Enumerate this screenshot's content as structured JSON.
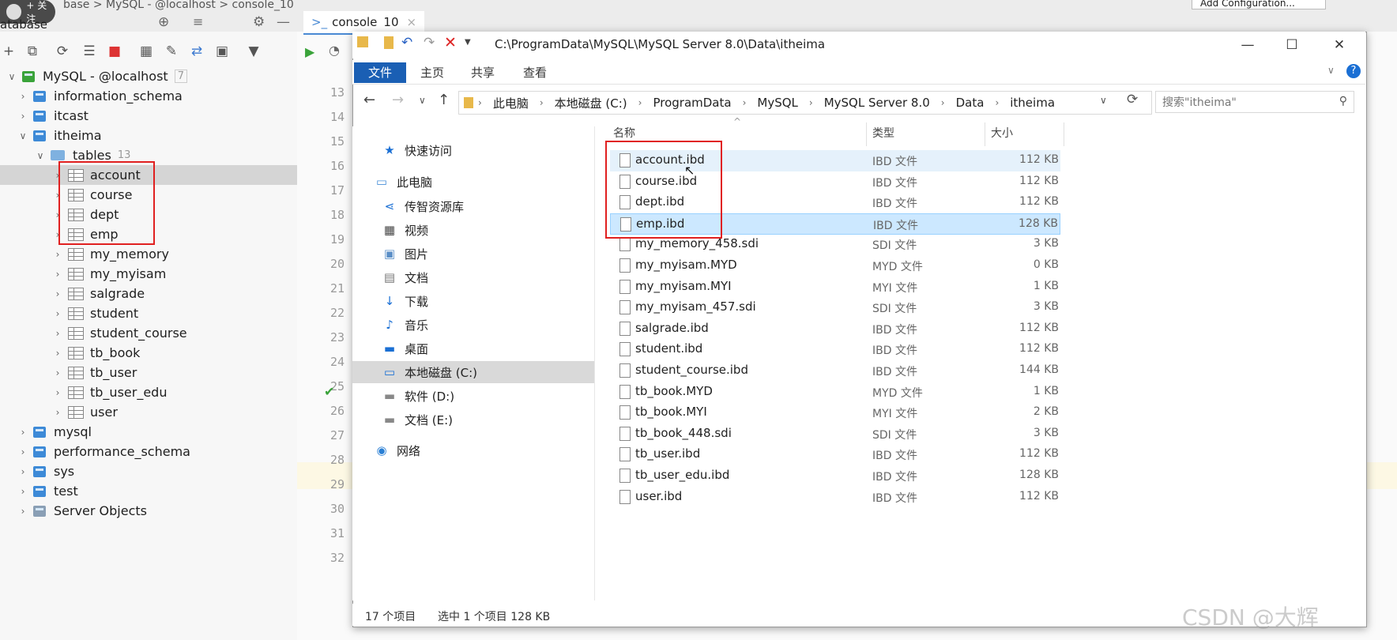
{
  "ide": {
    "top_crumbs": "base > MySQL - @localhost > console_10",
    "follow_badge": "+ 关注",
    "panel_title": "atabase",
    "run_config": "Add Configuration...",
    "console_tab": "console",
    "console_tab_num": "10",
    "tree": [
      {
        "label": "MySQL - @localhost",
        "count": "7"
      },
      {
        "label": "information_schema"
      },
      {
        "label": "itcast"
      },
      {
        "label": "itheima"
      },
      {
        "label": "tables",
        "count": "13"
      },
      {
        "label": "account"
      },
      {
        "label": "course"
      },
      {
        "label": "dept"
      },
      {
        "label": "emp"
      },
      {
        "label": "my_memory"
      },
      {
        "label": "my_myisam"
      },
      {
        "label": "salgrade"
      },
      {
        "label": "student"
      },
      {
        "label": "student_course"
      },
      {
        "label": "tb_book"
      },
      {
        "label": "tb_user"
      },
      {
        "label": "tb_user_edu"
      },
      {
        "label": "user"
      },
      {
        "label": "mysql"
      },
      {
        "label": "performance_schema"
      },
      {
        "label": "sys"
      },
      {
        "label": "test"
      },
      {
        "label": "Server Objects"
      }
    ],
    "line_numbers": [
      "13",
      "14",
      "15",
      "16",
      "17",
      "18",
      "19",
      "20",
      "21",
      "22",
      "23",
      "24",
      "25",
      "26",
      "27",
      "28",
      "29",
      "30",
      "31",
      "32"
    ]
  },
  "explorer": {
    "title_path": "C:\\ProgramData\\MySQL\\MySQL Server 8.0\\Data\\itheima",
    "ribbon_tabs": [
      "文件",
      "主页",
      "共享",
      "查看"
    ],
    "address": [
      "此电脑",
      "本地磁盘 (C:)",
      "ProgramData",
      "MySQL",
      "MySQL Server 8.0",
      "Data",
      "itheima"
    ],
    "search_placeholder": "搜索\"itheima\"",
    "nav": [
      {
        "label": "快速访问",
        "icon": "star-icon"
      },
      {
        "label": "此电脑",
        "icon": "computer-icon"
      },
      {
        "label": "传智资源库",
        "icon": "share-icon"
      },
      {
        "label": "视频",
        "icon": "video-icon"
      },
      {
        "label": "图片",
        "icon": "picture-icon"
      },
      {
        "label": "文档",
        "icon": "document-icon"
      },
      {
        "label": "下载",
        "icon": "download-icon"
      },
      {
        "label": "音乐",
        "icon": "music-icon"
      },
      {
        "label": "桌面",
        "icon": "desktop-icon"
      },
      {
        "label": "本地磁盘 (C:)",
        "icon": "drive-icon"
      },
      {
        "label": "软件 (D:)",
        "icon": "drive-icon"
      },
      {
        "label": "文档 (E:)",
        "icon": "drive-icon"
      },
      {
        "label": "网络",
        "icon": "network-icon"
      }
    ],
    "columns": {
      "name": "名称",
      "type": "类型",
      "size": "大小"
    },
    "files": [
      {
        "name": "account.ibd",
        "type": "IBD 文件",
        "size": "112 KB"
      },
      {
        "name": "course.ibd",
        "type": "IBD 文件",
        "size": "112 KB"
      },
      {
        "name": "dept.ibd",
        "type": "IBD 文件",
        "size": "112 KB"
      },
      {
        "name": "emp.ibd",
        "type": "IBD 文件",
        "size": "128 KB"
      },
      {
        "name": "my_memory_458.sdi",
        "type": "SDI 文件",
        "size": "3 KB"
      },
      {
        "name": "my_myisam.MYD",
        "type": "MYD 文件",
        "size": "0 KB"
      },
      {
        "name": "my_myisam.MYI",
        "type": "MYI 文件",
        "size": "1 KB"
      },
      {
        "name": "my_myisam_457.sdi",
        "type": "SDI 文件",
        "size": "3 KB"
      },
      {
        "name": "salgrade.ibd",
        "type": "IBD 文件",
        "size": "112 KB"
      },
      {
        "name": "student.ibd",
        "type": "IBD 文件",
        "size": "112 KB"
      },
      {
        "name": "student_course.ibd",
        "type": "IBD 文件",
        "size": "144 KB"
      },
      {
        "name": "tb_book.MYD",
        "type": "MYD 文件",
        "size": "1 KB"
      },
      {
        "name": "tb_book.MYI",
        "type": "MYI 文件",
        "size": "2 KB"
      },
      {
        "name": "tb_book_448.sdi",
        "type": "SDI 文件",
        "size": "3 KB"
      },
      {
        "name": "tb_user.ibd",
        "type": "IBD 文件",
        "size": "112 KB"
      },
      {
        "name": "tb_user_edu.ibd",
        "type": "IBD 文件",
        "size": "128 KB"
      },
      {
        "name": "user.ibd",
        "type": "IBD 文件",
        "size": "112 KB"
      }
    ],
    "status": {
      "count": "17 个项目",
      "selected": "选中 1 个项目  128 KB"
    }
  },
  "watermark": "CSDN @大辉",
  "colors": {
    "accent": "#1a5fb4",
    "highlight_box": "#e02020",
    "selected_row": "#cce8ff"
  }
}
